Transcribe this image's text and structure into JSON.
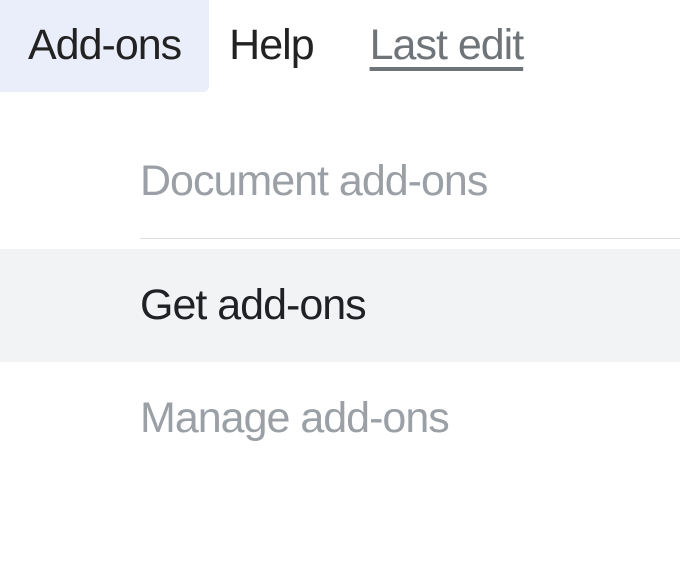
{
  "menubar": {
    "addons_label": "Add-ons",
    "help_label": "Help",
    "lastedit_label": "Last edit "
  },
  "dropdown": {
    "document_addons_label": "Document add-ons",
    "get_addons_label": "Get add-ons",
    "manage_addons_label": "Manage add-ons"
  }
}
